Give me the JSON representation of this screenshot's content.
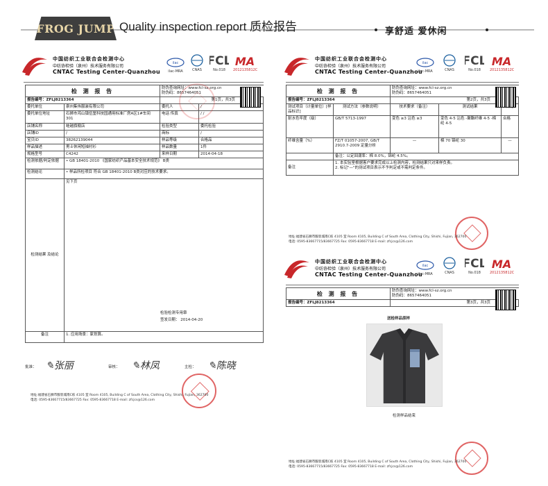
{
  "banner": {
    "logo": "FROG JUMP",
    "title": "Quality inspection report 质检报告",
    "slogan": "享舒适 爱休闲"
  },
  "org": {
    "line1": "中国纺织工业联合会检测中心",
    "line2": "中纺协检验（泉州）技术服务有限公司",
    "line3": "CNTAC Testing Center-Quanzhou",
    "cert1": "ilac-MRA",
    "cert2": "CNAS",
    "cert3": "No.018",
    "cert4": "MA"
  },
  "page1": {
    "title": "检 测 报 告",
    "query_label": "防伪查询网址：www.fcl-sz.org.cn",
    "query_code": "防伪码：8657464051",
    "report_no": "报告编号：ZFLJ8213364",
    "page_no": "第1页，共3页",
    "rows": [
      [
        "委托单位",
        "泉州集伟服装有限公司",
        "委托人",
        "/"
      ],
      [
        "委托单位地址",
        "石狮市鸿山镇伍堡科技园通用标准厂房A区1#车间 301",
        "电话 传真",
        "/ /"
      ],
      [
        "店铺名称",
        "蛙越旗舰店",
        "检验类型",
        "委托检验"
      ],
      [
        "店铺ID",
        "/",
        "商标",
        "/"
      ],
      [
        "宝贝ID",
        "38262139044",
        "样品等级",
        "合格品"
      ],
      [
        "样品描述",
        "男士休闲短袖衬衫",
        "样品数量",
        "1件"
      ],
      [
        "规格型号",
        "C4242",
        "来样日期",
        "2014-04-18"
      ]
    ],
    "basis_label": "检测依据/判定依据",
    "basis": "• GB 18401-2010 《国家纺织产品基本安全技术规范》 B类",
    "conclusion_label": "检测结论",
    "conclusion": "• 样品所检项目 符合 GB 18401-2010 B类对应的技术要求。",
    "result_label": "检测结果 及结论",
    "result_note": "见下页",
    "seal_label": "检验检测专用章",
    "issue_date_label": "签发日期：",
    "issue_date": "2014-04-20",
    "remark_label": "备注",
    "remark": "1. 应用场景：家划算。",
    "approver_label": "批准：",
    "reviewer_label": "审核：",
    "maker_label": "主检："
  },
  "page2": {
    "title": "检 测 报 告",
    "query_label": "防伪查询网址：www.fcl-sz.org.cn",
    "query_code": "防伪码：8657464051",
    "report_no": "报告编号：ZFLJ8213364",
    "page_no": "第2页，共3页",
    "header": [
      "测试项目（计量单位）[样品标识]",
      "测试方法（参数说明）",
      "技术要求（备注）",
      "测试结果",
      "判定"
    ],
    "rows": [
      [
        "耐水色牢度（级）",
        "GB/T 5713-1997",
        "变色 ≥3 沾色 ≥3",
        "变色 4-5 沾色 -聚酯纤维 4-5 -棉纶 4-5",
        "合格"
      ],
      [
        "纤维含量（%）",
        "FZ/T 01057-2007, GB/T 2910.7-2009 定量分析",
        "—",
        "棉 70 锦纶 30",
        "—"
      ]
    ],
    "tolerance_note": "备注：公定回潮率：棉 8.0%，锦纶 4.5%。",
    "remark_label": "备注",
    "remark1": "1. 本实验室根据客户要求完成以上检测内容，检测结果只对来样负责。",
    "remark2": "2. 标记\"—\"的测试项目表示不予判定或不需判定条件。"
  },
  "page3": {
    "title": "检 测 报 告",
    "query_label": "防伪查询网址：www.fcl-sz.org.cn",
    "query_code": "防伪码：8657464051",
    "report_no": "报告编号：ZFLJ8213364",
    "page_no": "第3页，共3页",
    "photo_title": "送检样品原样",
    "photo_caption": "检测样品结束"
  },
  "footer": {
    "addr": "地址:福建省石狮市服装城南C栋 4105 室     Room 4105, Building C of South Area, Clothing City, Shishi, Fujian, 362700",
    "tel": "电话: 0595-83667715/83667725     Fax: 0595-83667718     E-mail: zfcjcs@126.com"
  }
}
